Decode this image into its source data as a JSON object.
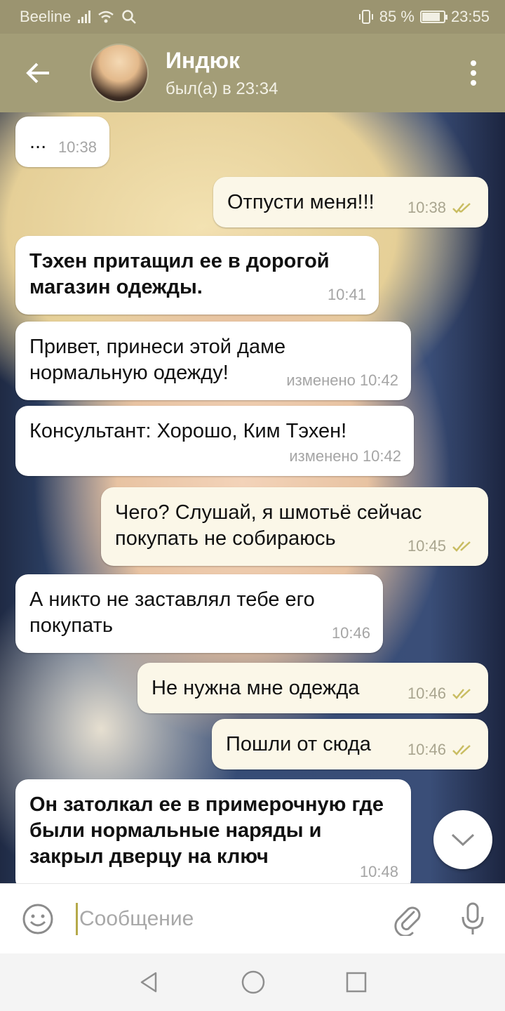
{
  "status_bar": {
    "carrier": "Beeline",
    "battery_percent": "85 %",
    "battery_level": 0.85,
    "time": "23:55"
  },
  "header": {
    "back_icon": "arrow-left-icon",
    "contact_name": "Индюк",
    "last_seen": "был(а) в 23:34",
    "menu_icon": "more-vertical-icon"
  },
  "messages": [
    {
      "dir": "in",
      "text": "...",
      "time": "10:38",
      "bold": false
    },
    {
      "dir": "out",
      "text": "Отпусти меня!!!",
      "time": "10:38",
      "bold": false
    },
    {
      "dir": "in",
      "text": "Тэхен притащил ее в дорогой магазин одежды.",
      "time": "10:41",
      "bold": true
    },
    {
      "dir": "in",
      "text": "Привет, принеси этой даме нормальную одежду!",
      "time": "изменено 10:42",
      "bold": false
    },
    {
      "dir": "in",
      "text": "Консультант: Хорошо, Ким Тэхен!",
      "time": "изменено 10:42",
      "bold": false
    },
    {
      "dir": "out",
      "text": "Чего? Слушай, я шмотьё сейчас покупать не собираюсь",
      "time": "10:45",
      "bold": false
    },
    {
      "dir": "in",
      "text": "А никто не заставлял тебе его покупать",
      "time": "10:46",
      "bold": false
    },
    {
      "dir": "out",
      "text": "Не нужна мне одежда",
      "time": "10:46",
      "bold": false
    },
    {
      "dir": "out",
      "text": "Пошли от сюда",
      "time": "10:46",
      "bold": false
    },
    {
      "dir": "in",
      "text": "Он затолкал ее в примерочную где были нормальные наряды и закрыл дверцу на ключ",
      "time": "10:48",
      "bold": true
    }
  ],
  "input": {
    "placeholder": "Сообщение",
    "emoji_icon": "emoji-icon",
    "attach_icon": "paperclip-icon",
    "mic_icon": "microphone-icon"
  },
  "nav": {
    "back_icon": "nav-back-icon",
    "home_icon": "nav-home-icon",
    "recents_icon": "nav-recents-icon"
  },
  "colors": {
    "header": "#a39d77",
    "status_bar": "#9b9470",
    "incoming_bubble": "#ffffff",
    "outgoing_bubble": "#fbf7e8",
    "read_checks": "#c9bd62"
  }
}
